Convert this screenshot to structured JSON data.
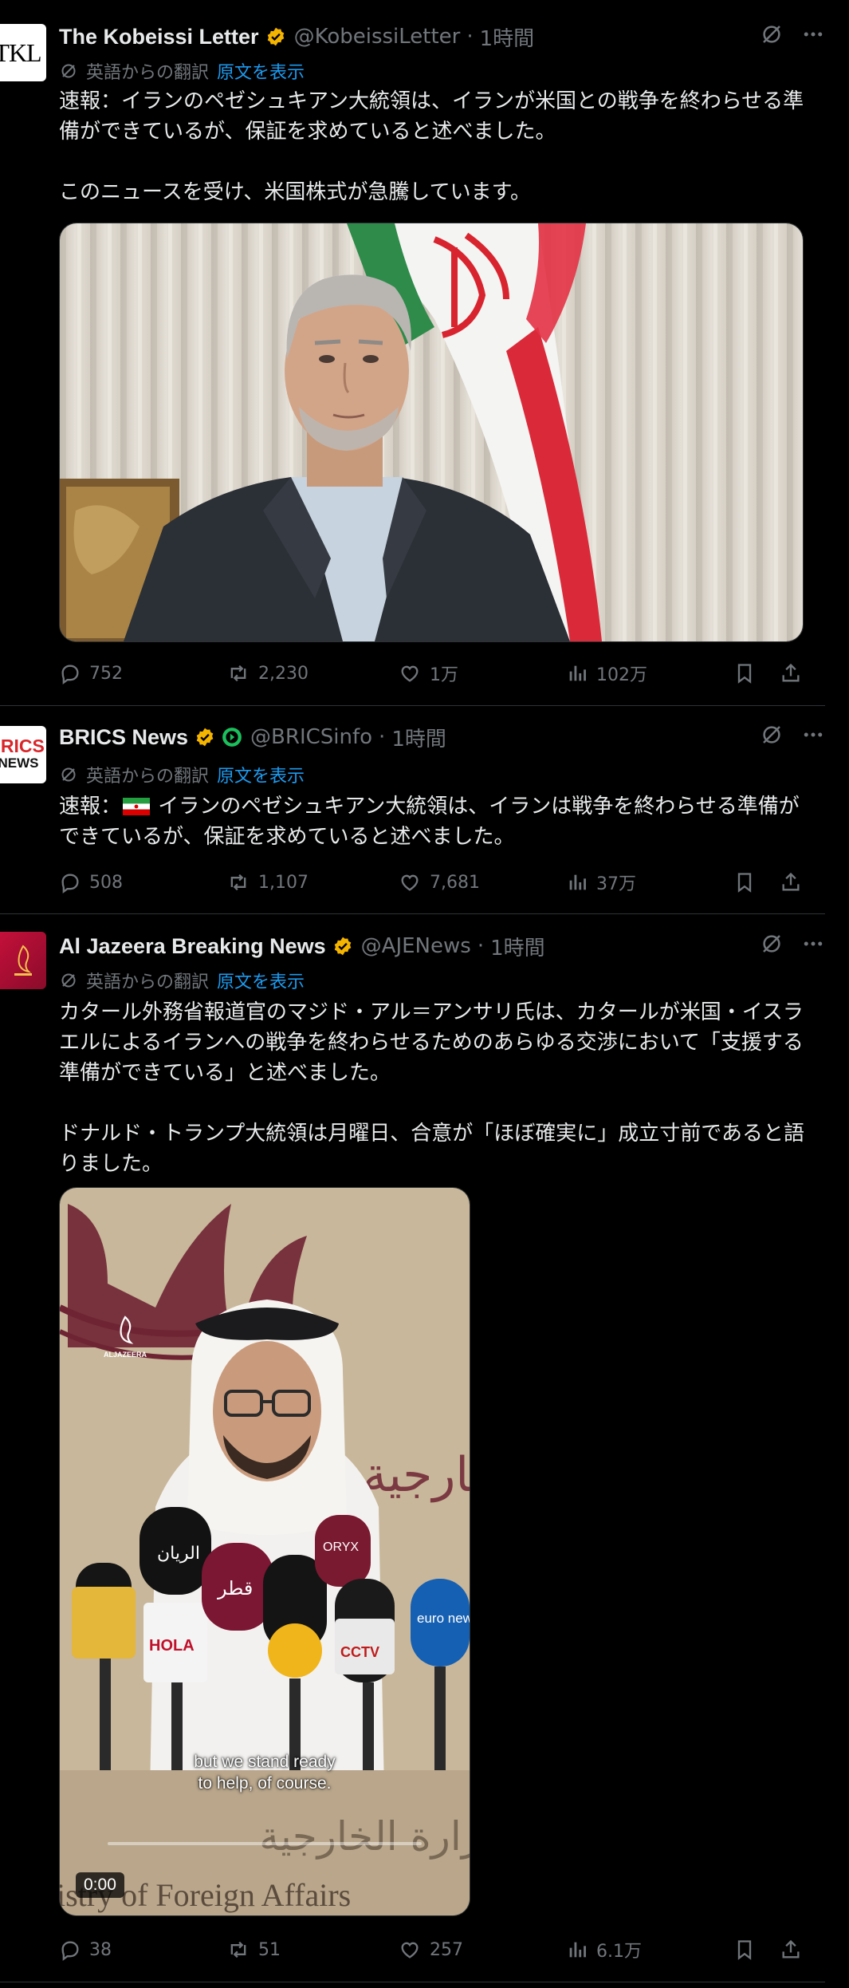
{
  "tweets": [
    {
      "name": "The Kobeissi Letter",
      "handle": "@KobeissiLetter",
      "dot": "·",
      "time": "1時間",
      "avatar_text": "TKL",
      "translated_from": "英語からの翻訳",
      "show_original": "原文を表示",
      "body": [
        "速報：イランのペゼシュキアン大統領は、イランが米国との戦争を終わらせる準備ができているが、保証を求めていると述べました。",
        "このニュースを受け、米国株式が急騰しています。"
      ],
      "replies": "752",
      "reposts": "2,230",
      "likes": "1万",
      "views": "102万"
    },
    {
      "name": "BRICS News",
      "handle": "@BRICSinfo",
      "dot": "·",
      "time": "1時間",
      "avatar_text_1": "BRICS",
      "avatar_text_2": "NEWS",
      "translated_from": "英語からの翻訳",
      "show_original": "原文を表示",
      "body_prefix": "速報：",
      "body_rest": " イランのペゼシュキアン大統領は、イランは戦争を終わらせる準備ができているが、保証を求めていると述べました。",
      "replies": "508",
      "reposts": "1,107",
      "likes": "7,681",
      "views": "37万"
    },
    {
      "name": "Al Jazeera Breaking News",
      "handle": "@AJENews",
      "dot": "·",
      "time": "1時間",
      "translated_from": "英語からの翻訳",
      "show_original": "原文を表示",
      "body": [
        "カタール外務省報道官のマジド・アル＝アンサリ氏は、カタールが米国・イスラエルによるイランへの戦争を終わらせるためのあらゆる交渉において「支援する準備ができている」と述べました。",
        "ドナルド・トランプ大統領は月曜日、合意が「ほぼ確実に」成立寸前であると語りました。"
      ],
      "video_caption_1": "but we stand ready",
      "video_caption_2": "to help, of course.",
      "video_time": "0:00",
      "video_watermark": "ALJAZEERA",
      "video_backdrop_text": "وزارة الخارجية",
      "video_backdrop_text_2": "istry of Foreign Affairs",
      "mic_labels": [
        "الريان",
        "قطر",
        "HOLA",
        "ORYX",
        "CCTV",
        "euro news."
      ],
      "replies": "38",
      "reposts": "51",
      "likes": "257",
      "views": "6.1万"
    }
  ],
  "colors": {
    "background": "#000000",
    "text": "#e7e9ea",
    "muted": "#71767b",
    "link": "#1d9bf0",
    "verified": "#f4b400",
    "divider": "#2f3336"
  },
  "icons": [
    "more-icon",
    "grok-icon",
    "reply-icon",
    "repost-icon",
    "like-icon",
    "views-icon",
    "bookmark-icon",
    "share-icon",
    "translate-icon",
    "verified-badge-icon"
  ]
}
